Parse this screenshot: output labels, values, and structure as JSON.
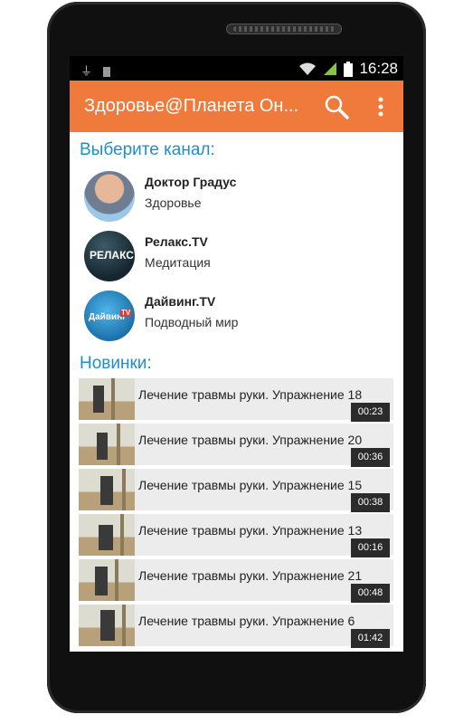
{
  "status_bar": {
    "time": "16:28",
    "icons": [
      "usb-icon",
      "sim-icon",
      "wifi-icon",
      "signal-icon",
      "battery-icon"
    ]
  },
  "app_bar": {
    "title": "Здоровье@Планета Он...",
    "icons": [
      "search-icon",
      "overflow-menu-icon"
    ],
    "color": "#f07a3c"
  },
  "channels_section": {
    "title": "Выберите канал:",
    "channels": [
      {
        "name": "Доктор Градус",
        "description": "Здоровье"
      },
      {
        "name": "Релакс.TV",
        "description": "Медитация",
        "logo_text": "РЕЛАКС"
      },
      {
        "name": "Дайвинг.TV",
        "description": "Подводный мир",
        "logo_text": "Дайвинг",
        "logo_badge": "TV"
      }
    ]
  },
  "new_section": {
    "title": "Новинки:",
    "videos": [
      {
        "title": "Лечение травмы руки. Упражнение 18",
        "duration": "00:23"
      },
      {
        "title": "Лечение травмы руки. Упражнение 20",
        "duration": "00:36"
      },
      {
        "title": "Лечение травмы руки. Упражнение 15",
        "duration": "00:38"
      },
      {
        "title": "Лечение травмы руки. Упражнение 13",
        "duration": "00:16"
      },
      {
        "title": "Лечение травмы руки. Упражнение 21",
        "duration": "00:48"
      },
      {
        "title": "Лечение травмы руки. Упражнение 6",
        "duration": "01:42"
      }
    ]
  },
  "accent_color": "#1e8fc7"
}
